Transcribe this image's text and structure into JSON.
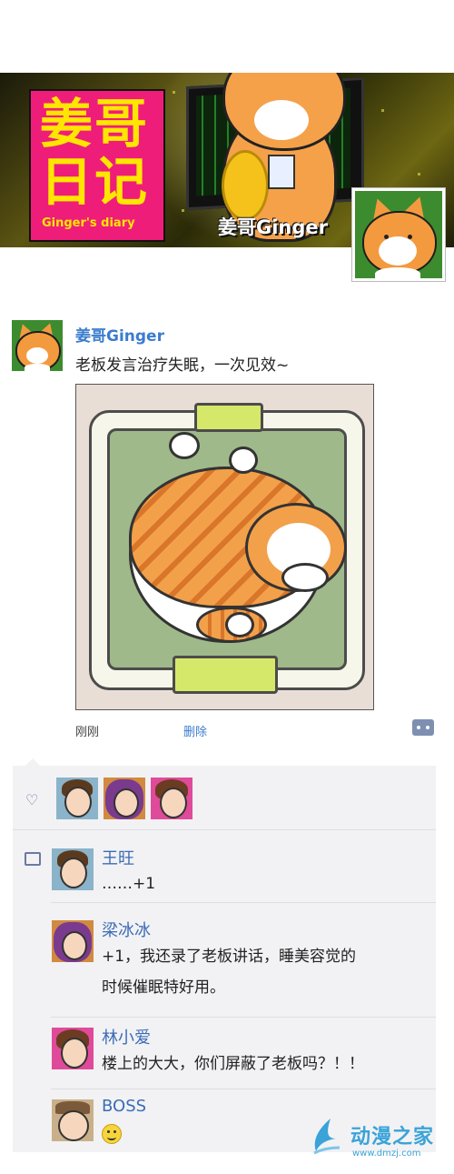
{
  "banner": {
    "logo_line1": "姜哥",
    "logo_line2": "日记",
    "logo_sub": "Ginger's diary",
    "name": "姜哥Ginger"
  },
  "post": {
    "author": "姜哥Ginger",
    "text": "老板发言治疗失眠，一次见效~",
    "time": "刚刚",
    "delete_label": "删除"
  },
  "comments": [
    {
      "name": "王旺",
      "lines": [
        "……+1"
      ]
    },
    {
      "name": "梁冰冰",
      "lines": [
        "+1，我还录了老板讲话，睡美容觉的",
        "时候催眠特好用。"
      ]
    },
    {
      "name": "林小爱",
      "lines": [
        "楼上的大大，你们屏蔽了老板吗？！！"
      ]
    },
    {
      "name": "BOSS",
      "lines": []
    }
  ],
  "watermark": {
    "text": "动漫之家",
    "url": "www.dmzj.com"
  },
  "icons": {
    "like": "heart-icon",
    "comment": "comment-icon",
    "more": "more-dots-icon",
    "smile": "smile-emoji-icon"
  },
  "colors": {
    "author_blue": "#3b7ccf",
    "logo_pink": "#ef1d7a",
    "logo_yellow": "#ffe600",
    "panel_bg": "#f2f2f4"
  }
}
